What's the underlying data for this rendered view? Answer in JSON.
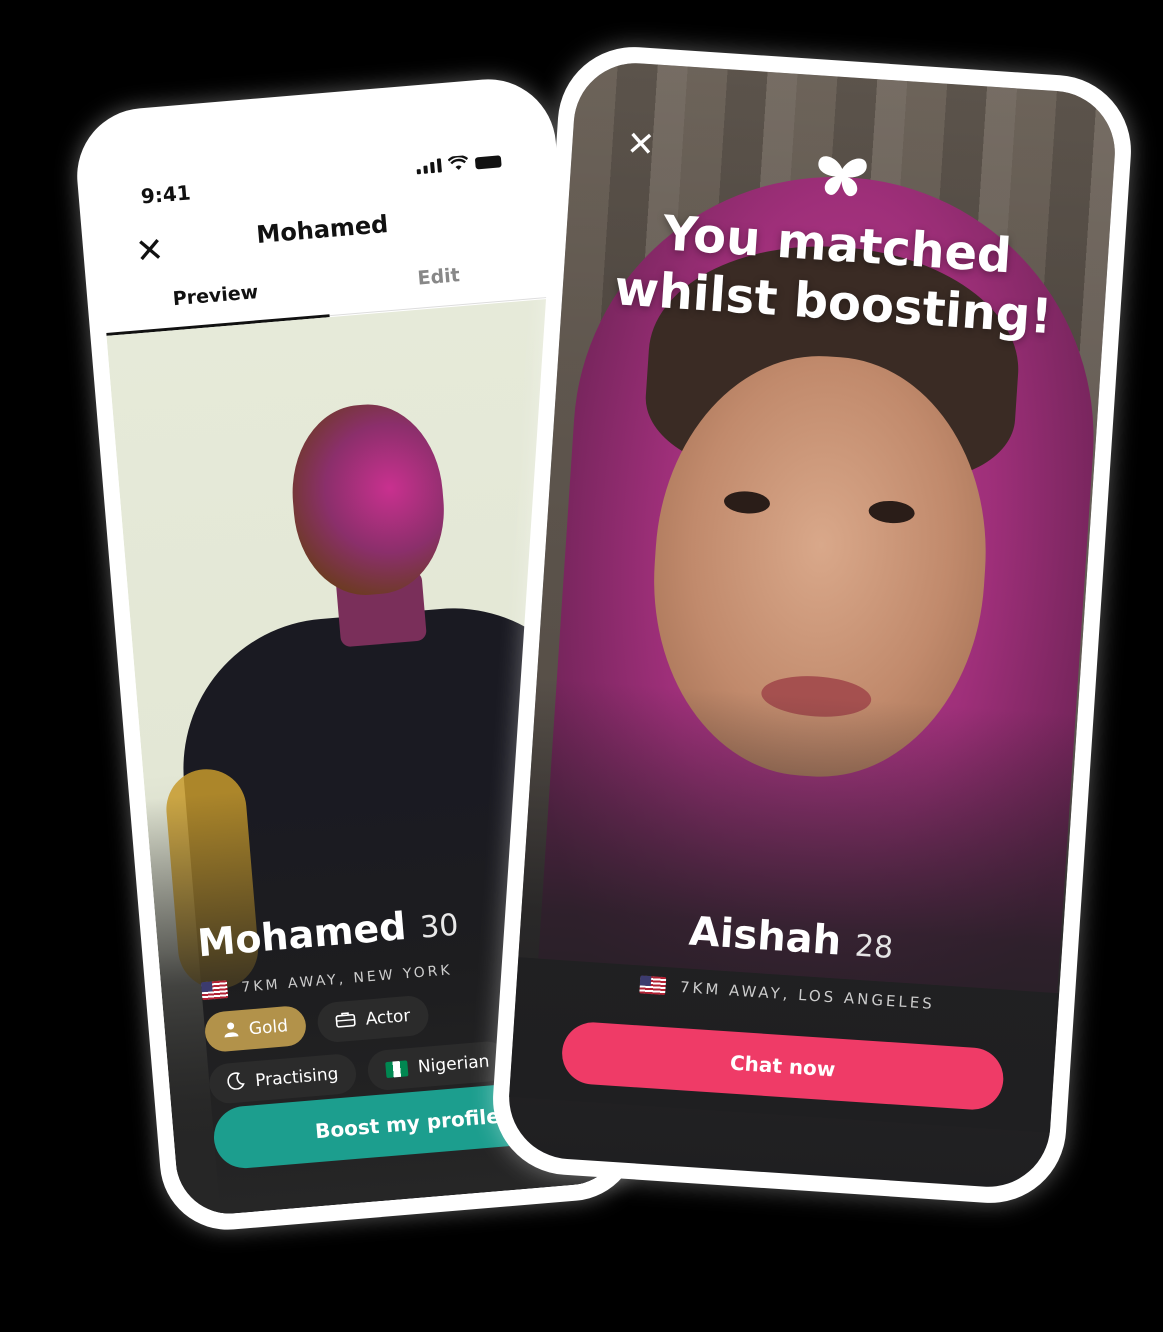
{
  "left_phone": {
    "status": {
      "time": "9:41"
    },
    "header": {
      "title": "Mohamed",
      "close_icon": "close-icon"
    },
    "tabs": [
      {
        "label": "Preview",
        "active": true
      },
      {
        "label": "Edit",
        "active": false
      }
    ],
    "profile": {
      "name": "Mohamed",
      "age": "30",
      "location": "7KM AWAY, NEW YORK",
      "flag": "us-flag-icon",
      "tags": [
        {
          "label": "Gold",
          "icon": "person-icon",
          "style": "gold"
        },
        {
          "label": "Actor",
          "icon": "briefcase-icon",
          "style": "dark"
        },
        {
          "label": "Practising",
          "icon": "moon-icon",
          "style": "dark"
        },
        {
          "label": "Nigerian",
          "icon": "nigeria-flag-icon",
          "style": "dark"
        }
      ]
    },
    "cta": {
      "label": "Boost my profile"
    }
  },
  "right_phone": {
    "close_icon": "close-icon",
    "logo_icon": "butterfly-icon",
    "title_line1": "You matched",
    "title_line2": "whilst boosting!",
    "profile": {
      "name": "Aishah",
      "age": "28",
      "location": "7KM AWAY, LOS ANGELES",
      "flag": "us-flag-icon"
    },
    "cta": {
      "label": "Chat now"
    }
  },
  "colors": {
    "background": "#000000",
    "boost_button": "#1c9e8e",
    "chat_button": "#ef3b67",
    "gold_tag": "#b2924a",
    "dark_tag": "#2b2b2b"
  }
}
